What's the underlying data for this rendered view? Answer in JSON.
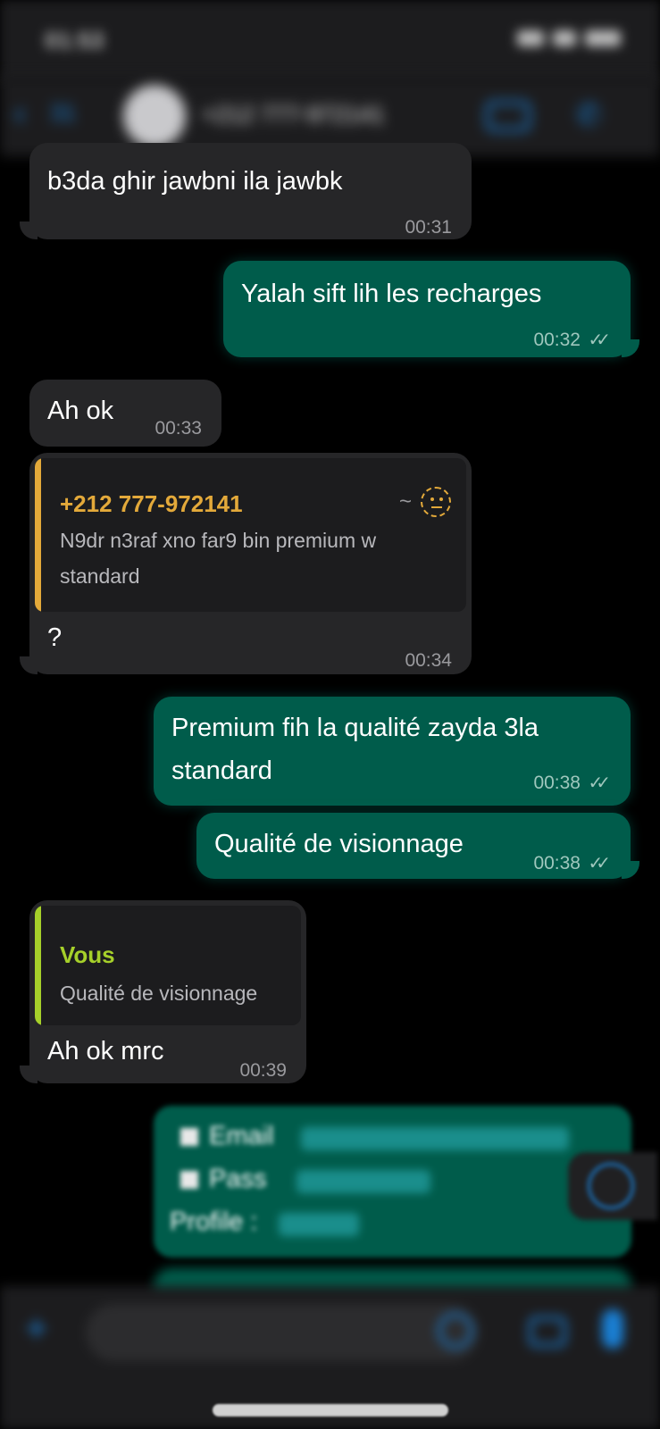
{
  "status_bar": {
    "time": "01:53"
  },
  "header": {
    "back_glyph": "‹",
    "unread_count": "31",
    "contact_name": "+212 777-972141",
    "icons": [
      "back-icon",
      "avatar",
      "video-call-icon",
      "phone-call-icon"
    ]
  },
  "messages": [
    {
      "direction": "in",
      "text": "b3da ghir jawbni ila jawbk",
      "time": "00:31"
    },
    {
      "direction": "out",
      "text": "Yalah sift lih les recharges",
      "time": "00:32",
      "status": "read"
    },
    {
      "direction": "in",
      "text": "Ah ok",
      "time": "00:33"
    },
    {
      "direction": "in",
      "quote": {
        "author": "+212 777-972141",
        "author_prefix": "~",
        "line1": "N9dr n3raf xno far9 bin premium w",
        "line2": "standard"
      },
      "text": "?",
      "time": "00:34"
    },
    {
      "direction": "out",
      "line1": "Premium fih la qualité zayda 3la",
      "line2": "standard",
      "time": "00:38",
      "status": "read"
    },
    {
      "direction": "out",
      "text": "Qualité de visionnage",
      "time": "00:38",
      "status": "read"
    },
    {
      "direction": "in",
      "quote": {
        "author": "Vous",
        "line1": "Qualité de visionnage"
      },
      "text": "Ah ok mrc",
      "time": "00:39"
    },
    {
      "direction": "out",
      "blurred": true,
      "lines": [
        "Email",
        "Pass",
        "Profile :"
      ]
    }
  ],
  "composer": {
    "icons": [
      "plus-icon",
      "sticker-icon",
      "camera-icon",
      "microphone-icon"
    ]
  },
  "colors": {
    "background": "#000000",
    "incoming_bubble": "#262628",
    "outgoing_bubble": "#005c4b",
    "quote_author_contact": "#e3a93a",
    "quote_author_self": "#a6d02a",
    "accent": "#1a7fd4",
    "read_ticks": "#9fc7bd"
  }
}
